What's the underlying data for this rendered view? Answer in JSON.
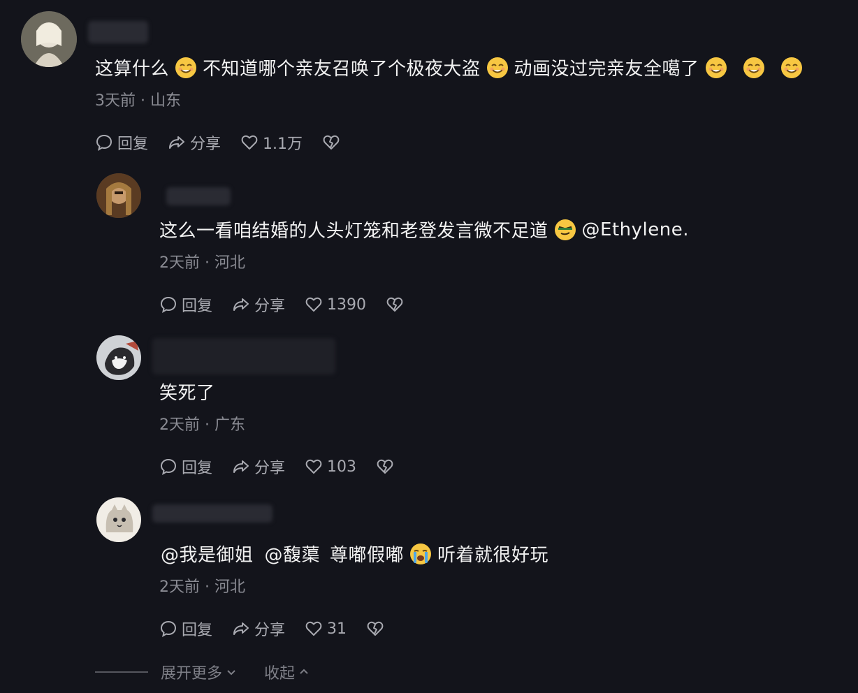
{
  "comments": [
    {
      "text_segments": [
        "这算什么",
        "不知道哪个亲友召唤了个极夜大盗",
        "动画没过完亲友全噶了"
      ],
      "trailing_emojis": 3,
      "meta": "3天前 · 山东",
      "reply_label": "回复",
      "share_label": "分享",
      "likes": "1.1万"
    },
    {
      "text_a": "这么一看咱结婚的人头灯笼和老登发言微不足道",
      "text_b": "@Ethylene.",
      "meta": "2天前 · 河北",
      "reply_label": "回复",
      "share_label": "分享",
      "likes": "1390"
    },
    {
      "text": "笑死了",
      "meta": "2天前 · 广东",
      "reply_label": "回复",
      "share_label": "分享",
      "likes": "103"
    },
    {
      "mention1": "@我是御姐",
      "mention2": "@馥蕖",
      "text_a": "尊嘟假嘟",
      "text_b": "听着就很好玩",
      "meta": "2天前 · 河北",
      "reply_label": "回复",
      "share_label": "分享",
      "likes": "31"
    }
  ],
  "footer": {
    "expand_label": "展开更多",
    "collapse_label": "收起"
  },
  "icons": {
    "reply": "comment-bubble-icon",
    "share": "share-arrow-icon",
    "like": "heart-icon",
    "dislike": "broken-heart-icon",
    "emoji_smile": "smiling-face-emoji",
    "emoji_sly": "sly-face-emoji",
    "emoji_cry": "crying-face-emoji"
  },
  "colors": {
    "background": "#13141b",
    "text": "#f2f2f2",
    "meta": "#8a8b93",
    "emoji_yellow": "#f7c742"
  }
}
